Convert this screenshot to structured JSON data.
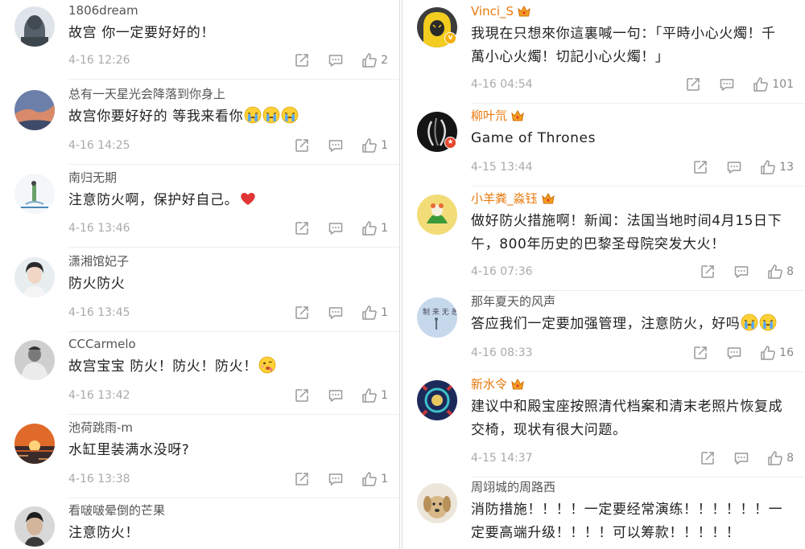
{
  "left": [
    {
      "user": "1806dream",
      "vip": false,
      "text": "故宫 你一定要好好的！",
      "emoji": [],
      "time": "4-16 12:26",
      "likes": "2",
      "avatar": "stone-lion-avatar",
      "badge": ""
    },
    {
      "user": "总有一天星光会降落到你身上",
      "vip": false,
      "text": "故宫你要好好的 等我来看你",
      "emoji": [
        "crying-face-emoji",
        "crying-face-emoji",
        "crying-face-emoji"
      ],
      "time": "4-16 14:25",
      "likes": "1",
      "avatar": "sky-avatar",
      "badge": ""
    },
    {
      "user": "南归无期",
      "vip": false,
      "text": "注意防火啊，保护好自己。",
      "emoji": [
        "red-heart-emoji"
      ],
      "time": "4-16 13:46",
      "likes": "1",
      "avatar": "sketch-avatar",
      "badge": ""
    },
    {
      "user": "潇湘馆妃子",
      "vip": false,
      "text": "防火防火",
      "emoji": [],
      "time": "4-16 13:45",
      "likes": "1",
      "avatar": "woman-avatar",
      "badge": ""
    },
    {
      "user": "CCCarmelo",
      "vip": false,
      "text": "故宫宝宝 防火！防火！防火！",
      "emoji": [
        "drooling-face-emoji"
      ],
      "time": "4-16 13:42",
      "likes": "1",
      "avatar": "man-bw-avatar",
      "badge": ""
    },
    {
      "user": "池荷跳雨-m",
      "vip": false,
      "text": "水缸里装满水没呀?",
      "emoji": [],
      "time": "4-16 13:38",
      "likes": "1",
      "avatar": "sunset-avatar",
      "badge": ""
    },
    {
      "user": "看啵啵晕倒的芒果",
      "vip": false,
      "text": "注意防火！",
      "emoji": [],
      "time": "",
      "likes": "",
      "avatar": "man-face-avatar",
      "badge": ""
    }
  ],
  "right": [
    {
      "user": "Vinci_S",
      "vip": true,
      "text": "我現在只想來你這裏喊一句：「平時小心火燭！千\n萬小心火燭！切記小心火燭！」",
      "emoji": [],
      "time": "4-16 04:54",
      "likes": "101",
      "avatar": "yellow-hood-avatar",
      "badge": "gold"
    },
    {
      "user": "柳叶氘",
      "vip": true,
      "text": "Game of Thrones",
      "emoji": [],
      "time": "4-15 13:44",
      "likes": "13",
      "avatar": "dark-art-avatar",
      "badge": "red"
    },
    {
      "user": "小羊粪_淼钰",
      "vip": true,
      "text": "做好防火措施啊！新闻：法国当地时间4月15日下\n午，800年历史的巴黎圣母院突发大火！",
      "emoji": [],
      "time": "4-16 07:36",
      "likes": "8",
      "avatar": "cartoon-avatar",
      "badge": ""
    },
    {
      "user": "那年夏天的风声",
      "vip": false,
      "text": "答应我们一定要加强管理，注意防火，好吗",
      "emoji": [
        "crying-face-emoji",
        "crying-face-emoji"
      ],
      "time": "4-16 08:33",
      "likes": "16",
      "avatar": "calligraphy-avatar",
      "badge": ""
    },
    {
      "user": "新水令",
      "vip": true,
      "text": "建议中和殿宝座按照清代档案和清末老照片恢复成\n交椅，现状有很大问题。",
      "emoji": [],
      "time": "4-15 14:37",
      "likes": "8",
      "avatar": "pattern-avatar",
      "badge": ""
    },
    {
      "user": "周翊城的周路西",
      "vip": false,
      "text": "消防措施！！！！一定要经常演练！！！！！！一\n定要高端升级！！！！可以筹款！！！！！",
      "emoji": [],
      "time": "",
      "likes": "",
      "avatar": "dog-avatar",
      "badge": ""
    }
  ],
  "colors": {
    "vip_name": "#e8790c",
    "name": "#555555",
    "time": "#aaaaaa",
    "text": "#222222"
  }
}
